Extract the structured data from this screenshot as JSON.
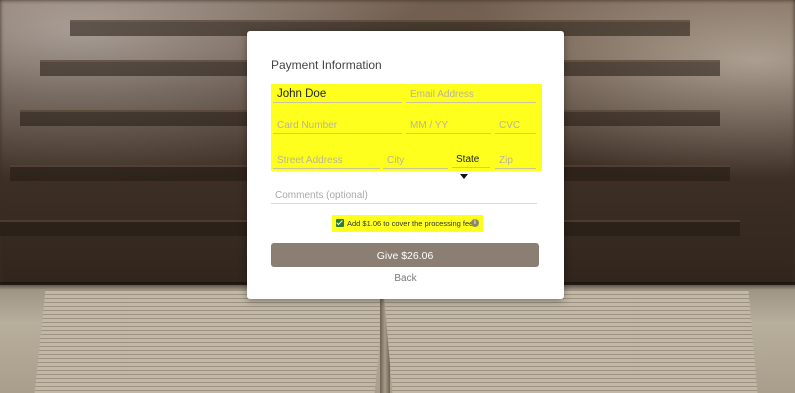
{
  "form": {
    "title": "Payment Information",
    "name_value": "John Doe",
    "email_placeholder": "Email Address",
    "card_placeholder": "Card Number",
    "expiry_placeholder": "MM / YY",
    "cvc_placeholder": "CVC",
    "street_placeholder": "Street Address",
    "city_placeholder": "City",
    "state_label": "State",
    "zip_placeholder": "Zip",
    "comments_placeholder": "Comments (optional)",
    "fee_checkbox_checked": true,
    "fee_label": "Add $1.06 to cover the processing fee",
    "info_icon": "info-icon",
    "give_button_label": "Give $26.06",
    "back_label": "Back"
  },
  "colors": {
    "highlight": "#ffff1e",
    "button": "#8b7e73",
    "card": "#ffffff"
  }
}
